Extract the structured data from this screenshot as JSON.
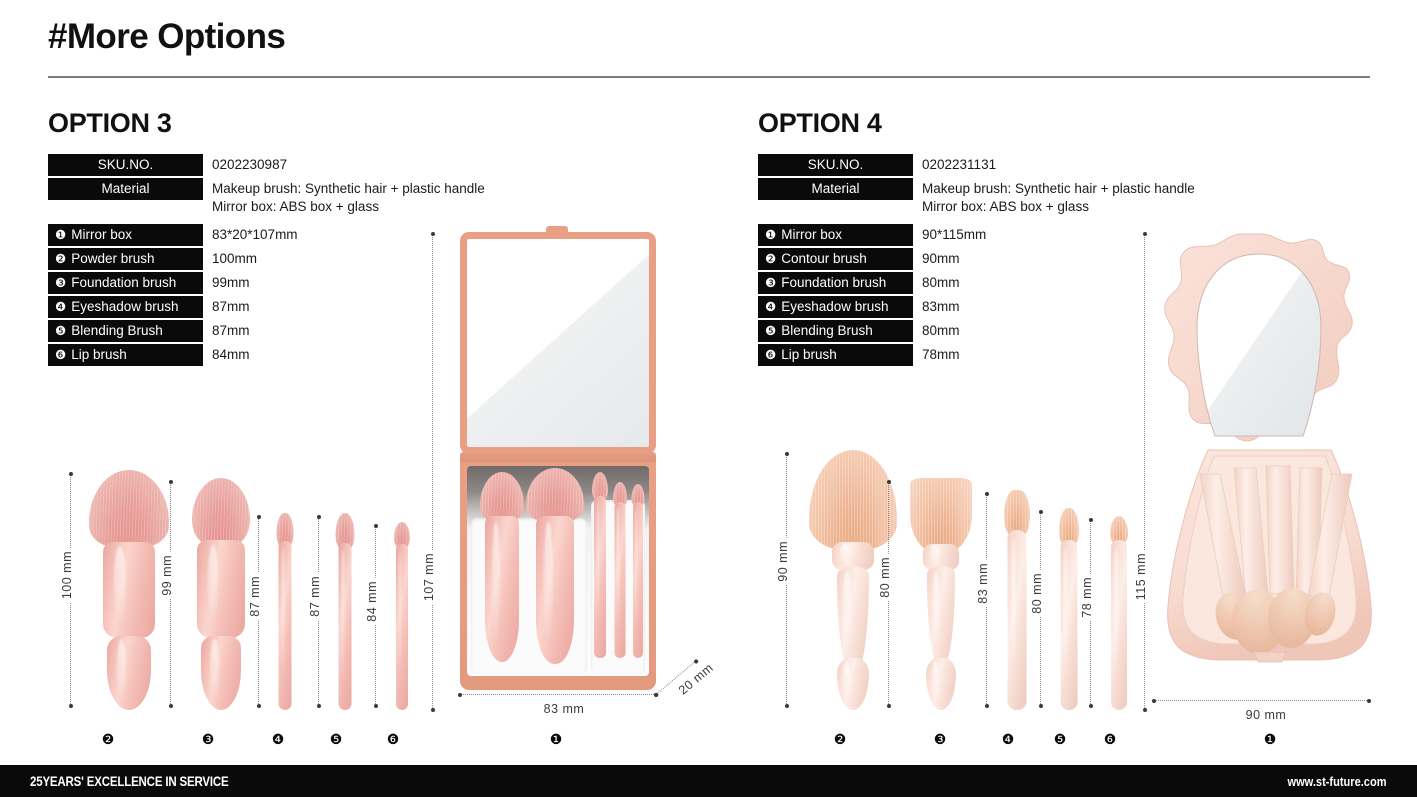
{
  "header": {
    "title": "#More Options"
  },
  "options": [
    {
      "title": "OPTION 3",
      "spec_rows": [
        {
          "key": "SKU.NO.",
          "value": "0202230987"
        },
        {
          "key": "Material",
          "value": "Makeup brush: Synthetic hair + plastic handle\nMirror box: ABS box + glass"
        }
      ],
      "item_rows": [
        {
          "badge": "❶",
          "key": "Mirror box",
          "value": "83*20*107mm"
        },
        {
          "badge": "❷",
          "key": "Powder brush",
          "value": "100mm"
        },
        {
          "badge": "❸",
          "key": "Foundation brush",
          "value": "99mm"
        },
        {
          "badge": "❹",
          "key": "Eyeshadow brush",
          "value": "87mm"
        },
        {
          "badge": "❺",
          "key": "Blending Brush",
          "value": "87mm"
        },
        {
          "badge": "❻",
          "key": "Lip brush",
          "value": "84mm"
        }
      ],
      "figures": [
        {
          "badge": "❷",
          "dimension": "100 mm"
        },
        {
          "badge": "❸",
          "dimension": "99 mm"
        },
        {
          "badge": "❹",
          "dimension": "87 mm"
        },
        {
          "badge": "❺",
          "dimension": "87 mm"
        },
        {
          "badge": "❻",
          "dimension": "84 mm"
        }
      ],
      "case": {
        "badge": "❶",
        "height_label": "107 mm",
        "width_label": "83 mm",
        "depth_label": "20 mm"
      }
    },
    {
      "title": "OPTION 4",
      "spec_rows": [
        {
          "key": "SKU.NO.",
          "value": "0202231131"
        },
        {
          "key": "Material",
          "value": "Makeup brush: Synthetic hair + plastic handle\nMirror box: ABS box + glass"
        }
      ],
      "item_rows": [
        {
          "badge": "❶",
          "key": "Mirror box",
          "value": "90*115mm"
        },
        {
          "badge": "❷",
          "key": "Contour brush",
          "value": "90mm"
        },
        {
          "badge": "❸",
          "key": "Foundation brush",
          "value": "80mm"
        },
        {
          "badge": "❹",
          "key": "Eyeshadow brush",
          "value": "83mm"
        },
        {
          "badge": "❺",
          "key": "Blending Brush",
          "value": "80mm"
        },
        {
          "badge": "❻",
          "key": "Lip brush",
          "value": "78mm"
        }
      ],
      "figures": [
        {
          "badge": "❷",
          "dimension": "90 mm"
        },
        {
          "badge": "❸",
          "dimension": "80 mm"
        },
        {
          "badge": "❹",
          "dimension": "83 mm"
        },
        {
          "badge": "❺",
          "dimension": "80 mm"
        },
        {
          "badge": "❻",
          "dimension": "78 mm"
        }
      ],
      "case": {
        "badge": "❶",
        "height_label": "115 mm",
        "width_label": "90 mm"
      }
    }
  ],
  "footer": {
    "tagline": "25YEARS' EXCELLENCE IN SERVICE",
    "website": "www.st-future.com"
  },
  "colors": {
    "accent_coral": "#e89f84",
    "brush_pink": "#f2bdb5",
    "brush_peach": "#f7d6c2",
    "bar_black": "#0a0a0a",
    "rule_gray": "#7d7d7d"
  }
}
